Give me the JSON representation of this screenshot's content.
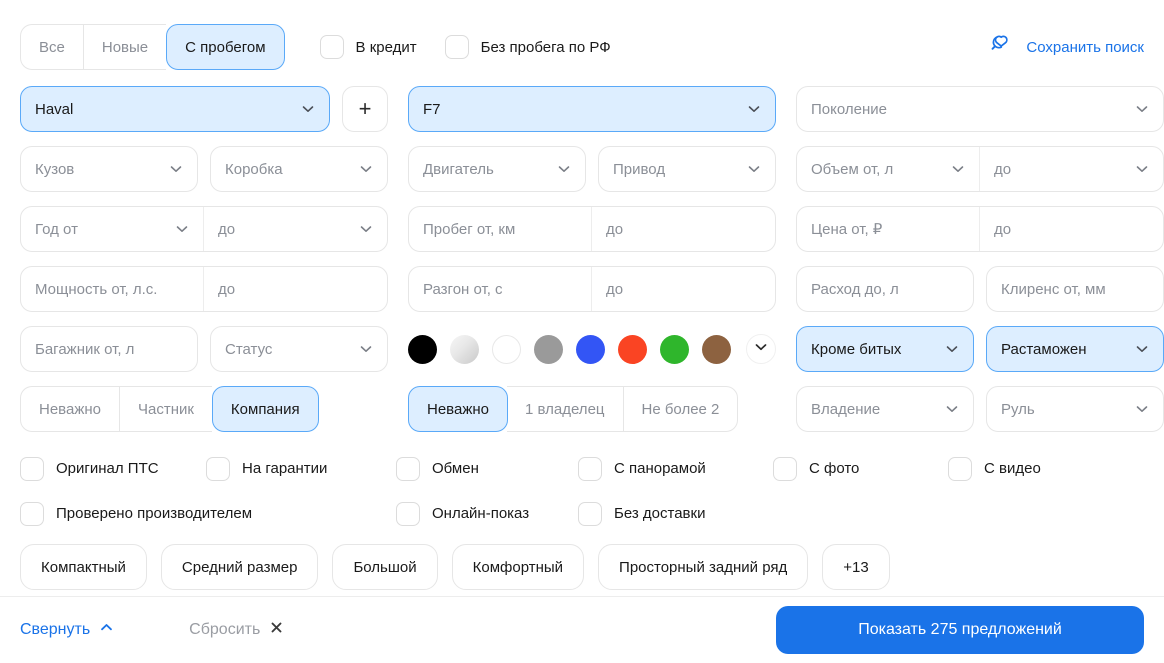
{
  "condition_tabs": [
    {
      "label": "Все",
      "selected": false
    },
    {
      "label": "Новые",
      "selected": false
    },
    {
      "label": "С пробегом",
      "selected": true
    }
  ],
  "top_checkboxes": [
    {
      "label": "В кредит",
      "checked": false
    },
    {
      "label": "Без пробега по РФ",
      "checked": false
    }
  ],
  "save_search": {
    "label": "Сохранить поиск",
    "icon": "search-heart-icon",
    "color": "#1a73e8"
  },
  "brand": {
    "value": "Haval",
    "selected": true
  },
  "add_brand_button": {
    "label": "+"
  },
  "model": {
    "value": "F7",
    "selected": true
  },
  "generation": {
    "placeholder": "Поколение"
  },
  "body_type": {
    "placeholder": "Кузов"
  },
  "transmission": {
    "placeholder": "Коробка"
  },
  "engine": {
    "placeholder": "Двигатель"
  },
  "drive": {
    "placeholder": "Привод"
  },
  "volume": {
    "from": "Объем от, л",
    "to": "до"
  },
  "year": {
    "from": "Год от",
    "to": "до"
  },
  "mileage": {
    "from": "Пробег от, км",
    "to": "до"
  },
  "price": {
    "from": "Цена от, ₽",
    "to": "до"
  },
  "power": {
    "from": "Мощность от, л.с.",
    "to": "до"
  },
  "acceleration": {
    "from": "Разгон от, с",
    "to": "до"
  },
  "consumption": {
    "placeholder": "Расход до, л"
  },
  "clearance": {
    "placeholder": "Клиренс от, мм"
  },
  "trunk": {
    "placeholder": "Багажник от, л"
  },
  "status": {
    "placeholder": "Статус"
  },
  "colors": [
    {
      "name": "black",
      "hex": "#000000",
      "ring": false
    },
    {
      "name": "silver",
      "hex": "#d8d8d8",
      "ring": false,
      "gradient": true
    },
    {
      "name": "white",
      "hex": "#ffffff",
      "ring": true
    },
    {
      "name": "gray",
      "hex": "#9a9a9a",
      "ring": false
    },
    {
      "name": "blue",
      "hex": "#3355f5",
      "ring": false
    },
    {
      "name": "red",
      "hex": "#fa4423",
      "ring": false
    },
    {
      "name": "green",
      "hex": "#2fb62c",
      "ring": false
    },
    {
      "name": "brown",
      "hex": "#8d6240",
      "ring": false
    }
  ],
  "damage": {
    "value": "Кроме битых",
    "selected": true
  },
  "customs": {
    "value": "Растаможен",
    "selected": true
  },
  "seller_tabs": [
    {
      "label": "Неважно",
      "selected": false
    },
    {
      "label": "Частник",
      "selected": false
    },
    {
      "label": "Компания",
      "selected": true
    }
  ],
  "owners_tabs": [
    {
      "label": "Неважно",
      "selected": true
    },
    {
      "label": "1 владелец",
      "selected": false
    },
    {
      "label": "Не более 2",
      "selected": false
    }
  ],
  "ownership": {
    "placeholder": "Владение"
  },
  "wheel": {
    "placeholder": "Руль"
  },
  "feature_checkboxes_row1": [
    {
      "label": "Оригинал ПТС",
      "checked": false
    },
    {
      "label": "На гарантии",
      "checked": false
    },
    {
      "label": "Обмен",
      "checked": false
    },
    {
      "label": "С панорамой",
      "checked": false
    },
    {
      "label": "С фото",
      "checked": false
    },
    {
      "label": "С видео",
      "checked": false
    }
  ],
  "feature_checkboxes_row2": [
    {
      "label": "Проверено производителем",
      "checked": false
    },
    {
      "label": "Онлайн-показ",
      "checked": false
    },
    {
      "label": "Без доставки",
      "checked": false
    }
  ],
  "tag_chips": [
    {
      "label": "Компактный"
    },
    {
      "label": "Средний размер"
    },
    {
      "label": "Большой"
    },
    {
      "label": "Комфортный"
    },
    {
      "label": "Просторный задний ряд"
    },
    {
      "label": "+13"
    }
  ],
  "footer": {
    "collapse_label": "Свернуть",
    "reset_label": "Сбросить",
    "submit_label": "Показать 275 предложений",
    "submit_color": "#1a73e8"
  }
}
